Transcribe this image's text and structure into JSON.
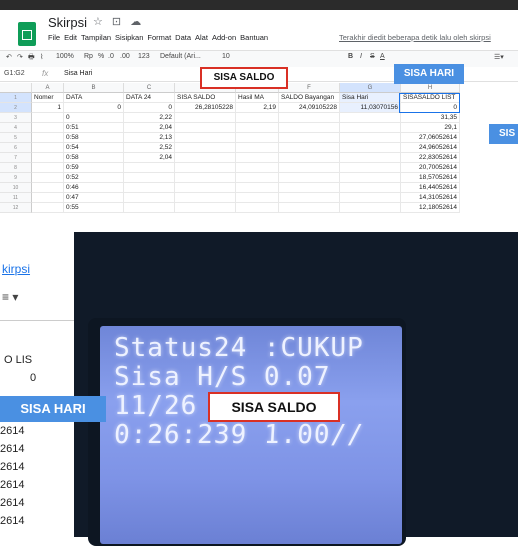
{
  "app": {
    "title": "Skirpsi",
    "title_icons": "☆ ⊡ ☁",
    "menu": [
      "File",
      "Edit",
      "Tampilan",
      "Sisipkan",
      "Format",
      "Data",
      "Alat",
      "Add-on",
      "Bantuan"
    ],
    "last_edit": "Terakhir diedit beberapa detik lalu oleh skirpsi"
  },
  "toolbar": {
    "undo_icon": "undo-icon",
    "redo_icon": "redo-icon",
    "print_icon": "print-icon",
    "paint_icon": "paint-format-icon",
    "zoom": "100%",
    "currency": "Rp",
    "percent": "%",
    "decimal_less": ".0",
    "decimal_more": ".00",
    "number_format": "123",
    "font": "Default (Ari...",
    "font_size": "10",
    "bold": "B",
    "italic": "I",
    "strike": "S",
    "text_color": "A"
  },
  "formula_bar": {
    "name_box": "G1:G2",
    "fx": "fx",
    "value": "Sisa Hari"
  },
  "columns": [
    "A",
    "B",
    "C",
    "D",
    "E",
    "F",
    "G",
    "H"
  ],
  "rows": [
    {
      "n": "1",
      "cells": [
        "Nomer",
        "DATA",
        "DATA 24",
        "SISA SALDO",
        "Hasil MA",
        "SALDO Bayangan",
        "Sisa Hari",
        "SISASALDO LIST"
      ]
    },
    {
      "n": "2",
      "cells": [
        "1",
        "0",
        "0",
        "26,28105228",
        "2,19",
        "24,09105228",
        "11,03070156",
        "0"
      ]
    },
    {
      "n": "3",
      "cells": [
        "",
        "0",
        "2,22",
        "",
        "",
        "",
        "",
        "31,35"
      ]
    },
    {
      "n": "4",
      "cells": [
        "",
        "0:51",
        "2,04",
        "",
        "",
        "",
        "",
        "29,1"
      ]
    },
    {
      "n": "5",
      "cells": [
        "",
        "0:58",
        "2,13",
        "",
        "",
        "",
        "",
        "27,06052614"
      ]
    },
    {
      "n": "6",
      "cells": [
        "",
        "0:54",
        "2,52",
        "",
        "",
        "",
        "",
        "24,96052614"
      ]
    },
    {
      "n": "7",
      "cells": [
        "",
        "0:58",
        "2,04",
        "",
        "",
        "",
        "",
        "22,83052614"
      ]
    },
    {
      "n": "8",
      "cells": [
        "",
        "0:59",
        "",
        "",
        "",
        "",
        "",
        "20,70052614"
      ]
    },
    {
      "n": "9",
      "cells": [
        "",
        "0:52",
        "",
        "",
        "",
        "",
        "",
        "18,57052614"
      ]
    },
    {
      "n": "10",
      "cells": [
        "",
        "0:46",
        "",
        "",
        "",
        "",
        "",
        "16,44052614"
      ]
    },
    {
      "n": "11",
      "cells": [
        "",
        "0:47",
        "",
        "",
        "",
        "",
        "",
        "14,31052614"
      ]
    },
    {
      "n": "12",
      "cells": [
        "",
        "0:55",
        "",
        "",
        "",
        "",
        "",
        "12,18052614"
      ]
    }
  ],
  "callouts": {
    "sisa_saldo_top": "SISA SALDO",
    "sisa_hari_top": "SISA HARI",
    "sis_partial": "SIS",
    "sisa_hari_bottom": "SISA HARI",
    "sisa_saldo_bottom": "SISA SALDO"
  },
  "photo_strip": {
    "link_text": "kirpsi",
    "icon": "≡ ▾",
    "header": "O LIS",
    "zero": "0",
    "values": [
      "2614",
      "2614",
      "2614",
      "2614",
      "2614",
      "2614"
    ]
  },
  "lcd": {
    "line1": "Status24 :CUKUP",
    "line2": "Sisa H/S 0.07",
    "line3": "11/26",
    "line4": "0:26:239 1.00//"
  },
  "colors": {
    "sheets_green": "#0f9d58",
    "callout_red": "#d93025",
    "callout_blue": "#4a90e2",
    "lcd_blue": "#7e93e6"
  }
}
